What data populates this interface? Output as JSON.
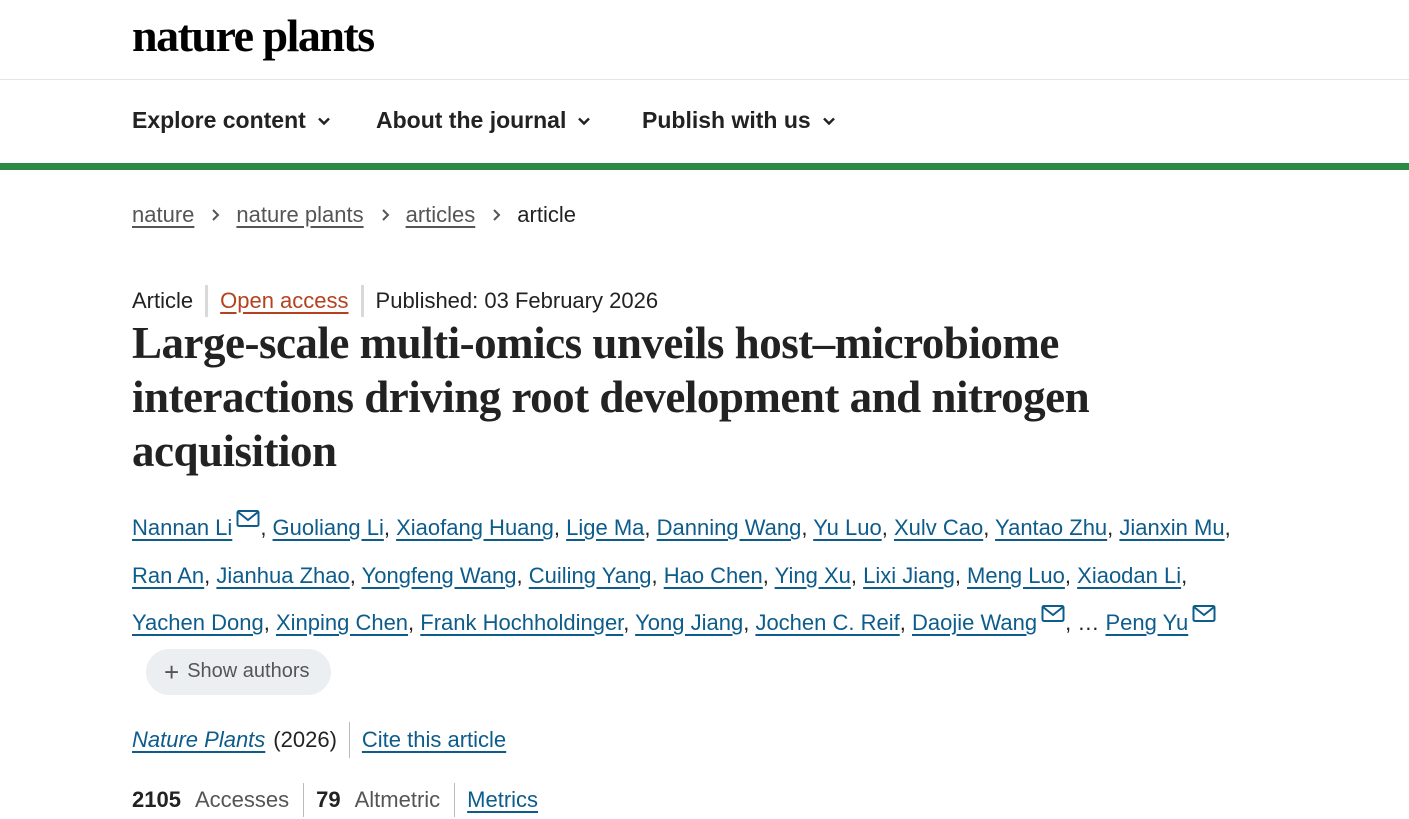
{
  "header": {
    "logo": "nature plants"
  },
  "nav": {
    "items": [
      {
        "label": "Explore content"
      },
      {
        "label": "About the journal"
      },
      {
        "label": "Publish with us"
      }
    ]
  },
  "breadcrumb": {
    "items": [
      "nature",
      "nature plants",
      "articles"
    ],
    "current": "article"
  },
  "article": {
    "type": "Article",
    "access": "Open access",
    "published": "Published: 03 February 2026",
    "title": "Large-scale multi-omics unveils host–microbiome interactions driving root development and nitrogen acquisition",
    "authors": [
      {
        "name": "Nannan Li",
        "email": true
      },
      {
        "name": "Guoliang Li"
      },
      {
        "name": "Xiaofang Huang"
      },
      {
        "name": "Lige Ma"
      },
      {
        "name": "Danning Wang"
      },
      {
        "name": "Yu Luo"
      },
      {
        "name": "Xulv Cao"
      },
      {
        "name": "Yantao Zhu"
      },
      {
        "name": "Jianxin Mu"
      },
      {
        "name": "Ran An"
      },
      {
        "name": "Jianhua Zhao"
      },
      {
        "name": "Yongfeng Wang"
      },
      {
        "name": "Cuiling Yang"
      },
      {
        "name": "Hao Chen"
      },
      {
        "name": "Ying Xu"
      },
      {
        "name": "Lixi Jiang"
      },
      {
        "name": "Meng Luo"
      },
      {
        "name": "Xiaodan Li"
      },
      {
        "name": "Yachen Dong"
      },
      {
        "name": "Xinping Chen"
      },
      {
        "name": "Frank Hochholdinger"
      },
      {
        "name": "Yong Jiang"
      },
      {
        "name": "Jochen C. Reif"
      },
      {
        "name": "Daojie Wang",
        "email": true
      }
    ],
    "ellipsis": "…",
    "last_author": "Peng Yu",
    "show_authors_label": "Show authors",
    "journal": "Nature Plants",
    "year": "(2026)",
    "cite_label": "Cite this article"
  },
  "metrics": {
    "accesses_value": "2105",
    "accesses_label": "Accesses",
    "altmetric_value": "79",
    "altmetric_label": "Altmetric",
    "metrics_link": "Metrics"
  },
  "colors": {
    "green_rule": "#2a8a46",
    "link": "#0d5c8c",
    "open_access": "#b4421f"
  }
}
